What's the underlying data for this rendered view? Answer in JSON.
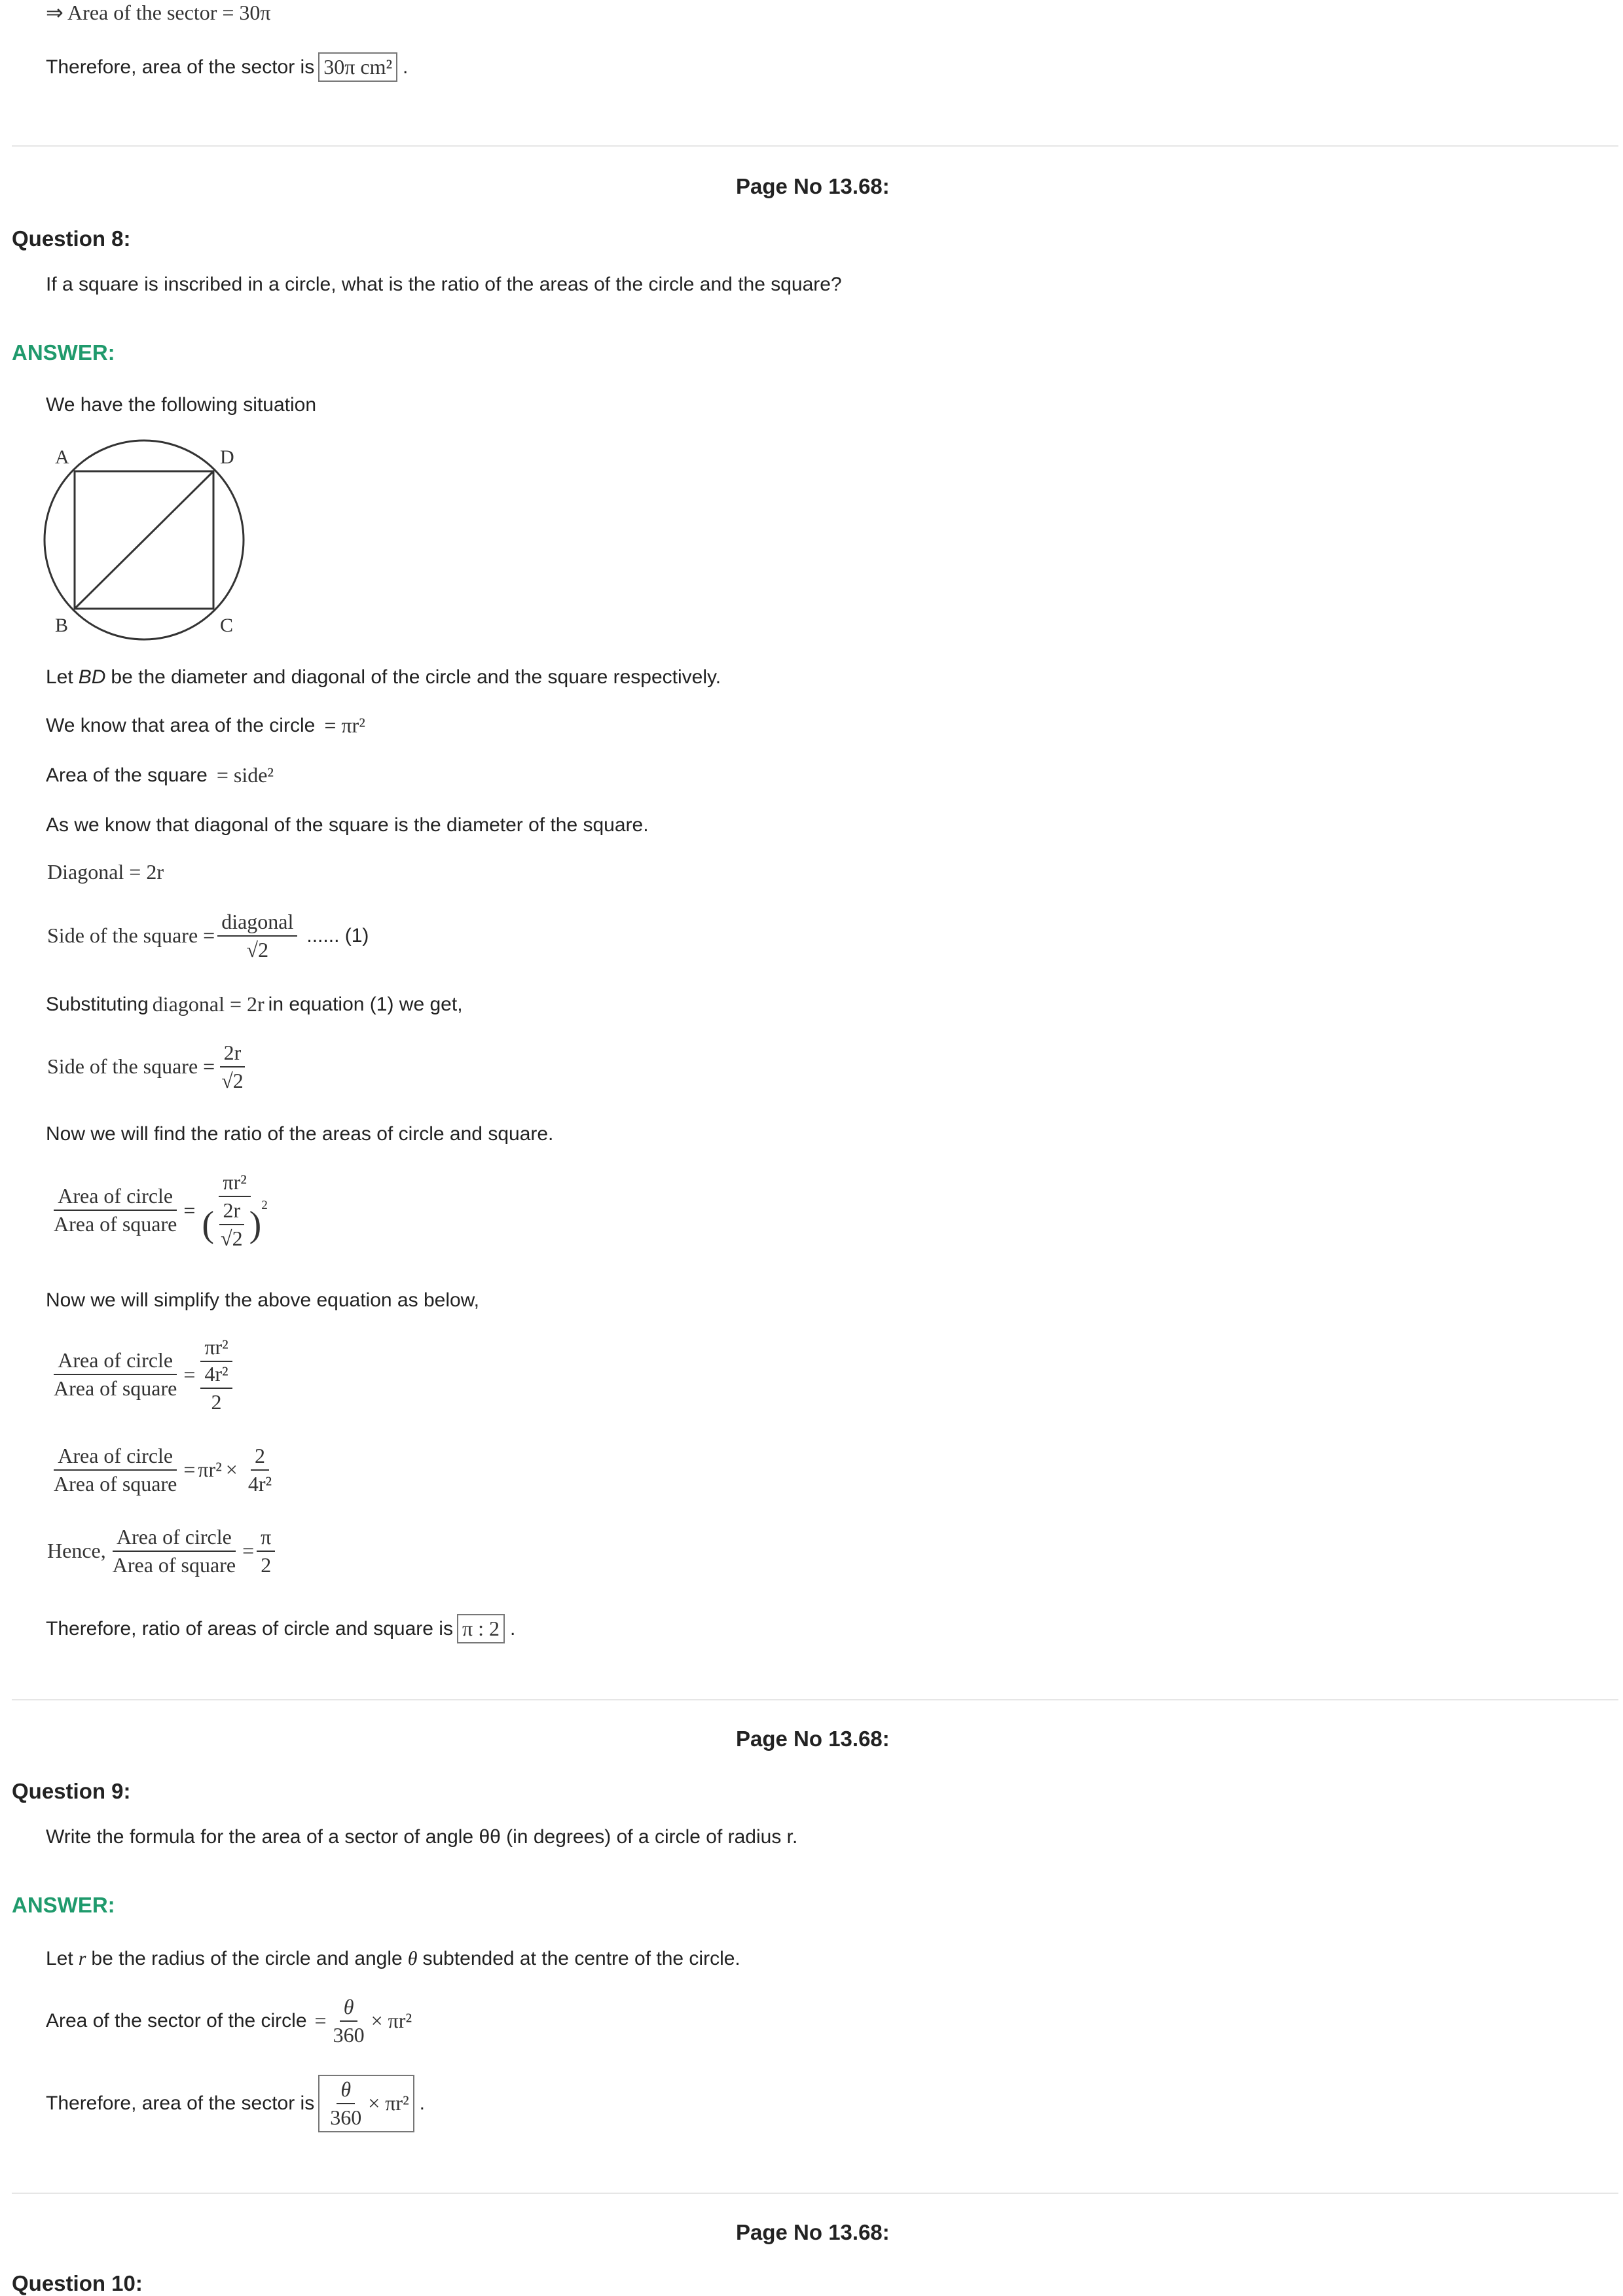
{
  "top": {
    "sector_line": "⇒ Area of the sector = 30π",
    "therefore_sector": "Therefore, area of the sector is",
    "sector_value": "30π cm²",
    "period": "."
  },
  "page_label": "Page No 13.68:",
  "q8": {
    "heading": "Question 8:",
    "text": "If a square is inscribed in a circle, what is the ratio of the areas of the circle and the square?",
    "answer_label": "ANSWER:",
    "situation": "We have the following situation",
    "figure_labels": {
      "a": "A",
      "b": "B",
      "c": "C",
      "d": "D"
    },
    "let_bd_1": "Let",
    "let_bd_var": "BD",
    "let_bd_2": "be the diameter and diagonal of the circle and the square respectively.",
    "know_area_circle": "We know that area of the circle",
    "area_circle_expr": "= πr²",
    "area_square": "Area of the square",
    "area_square_expr": "= side²",
    "diag_is_diam": "As we know that diagonal of the square is the diameter of the square.",
    "diagonal_eq": "Diagonal = 2r",
    "side_lhs": "Side of the square =",
    "side_num": "diagonal",
    "side_den": "√2",
    "eq_tag": "...... (1)",
    "subst_1": "Substituting",
    "subst_expr": "diagonal = 2r",
    "subst_2": "in equation (1) we get,",
    "side2_num": "2r",
    "side2_den": "√2",
    "find_ratio": "Now we will find the ratio of the areas of circle and square.",
    "area_of_circle": "Area of circle",
    "area_of_square": "Area of square",
    "pi_r2": "πr²",
    "simplify": "Now we will simplify the above equation as below,",
    "four_r2": "4r²",
    "two": "2",
    "times": "×",
    "hence": "Hence,",
    "pi": "π",
    "therefore_ratio": "Therefore, ratio of areas of circle and square is",
    "ratio_value": "π : 2"
  },
  "q9": {
    "heading": "Question 9:",
    "text": "Write the formula for the area of a sector of angle θθ (in degrees) of a circle of radius r.",
    "answer_label": "ANSWER:",
    "let_r_1": "Let",
    "let_r_var": "r",
    "let_r_2": "be the radius of the circle and angle",
    "let_r_theta": "θ",
    "let_r_3": "subtended at the centre of the circle.",
    "area_sector_circle": "Area of the sector of the circle",
    "theta": "θ",
    "three_sixty": "360",
    "times_pi_r2": "× πr²",
    "therefore_sector": "Therefore, area of the sector is"
  },
  "q10": {
    "heading": "Question 10:"
  }
}
